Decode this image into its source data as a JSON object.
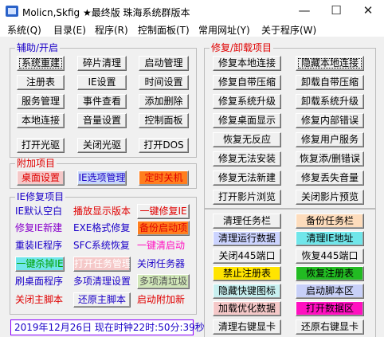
{
  "window": {
    "title": "Molicn,Skfig ★最终版 珠海系统群版本",
    "minimize": "—",
    "maximize": "☐",
    "close": "✕"
  },
  "menu": [
    "系统(Q)",
    "目录(E)",
    "程序(R)",
    "控制面板(T)",
    "常用网址(Y)",
    "关于程序(W)"
  ],
  "groups": {
    "aux": {
      "title": "辅助/开启",
      "buttons": [
        "系统重建",
        "碎片清理",
        "启动管理",
        "注册表",
        "IE设置",
        "时间设置",
        "服务管理",
        "事件查看",
        "添加删除",
        "本地连接",
        "音量设置",
        "控制面板",
        "打开光驱",
        "关闭光驱",
        "打开DOS"
      ]
    },
    "extra": {
      "title": "附加项目",
      "buttons": [
        "桌面设置",
        "IE选项管理",
        "定时关机"
      ]
    },
    "ie": {
      "title": "IE修复项目",
      "items": [
        "IE默认空白",
        "播放显示版本",
        "一键修复IE",
        "修复IE新建",
        "EXE格式修复",
        "备份启动项",
        "重装IE程序",
        "SFC系统恢复",
        "一键清启动",
        "一键杀掉IE",
        "打开任务管理",
        "关闭任务器",
        "刷桌面程序",
        "多项清理设置",
        "多项清垃圾",
        "关闭主脚本",
        "还原主脚本",
        "启动附加新"
      ]
    },
    "repair": {
      "title": "修复/卸载项目",
      "buttons": [
        "修复本地连接",
        "隐藏本地连接",
        "修复自带压缩",
        "卸载自带压缩",
        "修复系统升级",
        "卸载系统升级",
        "修复桌面显示",
        "修复内部错误",
        "恢复无反应",
        "修复用户服务",
        "修复无法安装",
        "恢复添/删错误",
        "修复无法新建",
        "修复丢失音量",
        "打开影片浏览",
        "关闭影片预览"
      ]
    },
    "tools": {
      "buttons": [
        "清理任务栏",
        "备份任务栏",
        "清理运行数据",
        "清理IE地址",
        "关闭445端口",
        "恢复445端口",
        "禁止注册表",
        "恢复注册表",
        "隐藏快键图标",
        "启动脚本区",
        "加载优化数据",
        "打开数据区",
        "清理右键显卡",
        "还原右键显卡"
      ]
    }
  },
  "status": {
    "text": "2019年12月26日 现在时钟22时:50分:39秒"
  },
  "colors": {
    "pink": "#f5c8c8",
    "blue_light": "#c8d8f8",
    "orange": "#ff7e1e",
    "teal": "#70e6ea",
    "yellow": "#ffe400",
    "green": "#22bb22",
    "magenta": "#ff10c0",
    "lavender": "#ccd4ff",
    "peach": "#fddcbc",
    "lightblue_btn": "#c8d0f8",
    "red_text": "#e00000",
    "blue_text": "#1a00d0",
    "purple_text": "#8800cc"
  }
}
